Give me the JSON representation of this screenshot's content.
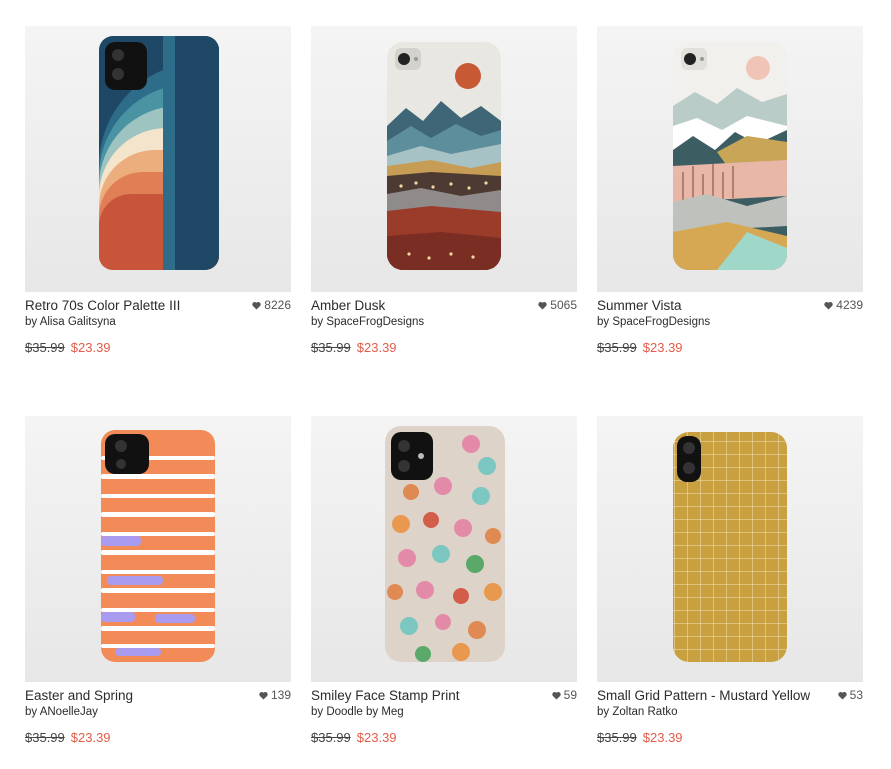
{
  "products": [
    {
      "title": "Retro 70s Color Palette III",
      "artist": "by Alisa Galitsyna",
      "likes": "8226",
      "original_price": "$35.99",
      "sale_price": "$23.39"
    },
    {
      "title": "Amber Dusk",
      "artist": "by SpaceFrogDesigns",
      "likes": "5065",
      "original_price": "$35.99",
      "sale_price": "$23.39"
    },
    {
      "title": "Summer Vista",
      "artist": "by SpaceFrogDesigns",
      "likes": "4239",
      "original_price": "$35.99",
      "sale_price": "$23.39"
    },
    {
      "title": "Easter and Spring",
      "artist": "by ANoelleJay",
      "likes": "139",
      "original_price": "$35.99",
      "sale_price": "$23.39"
    },
    {
      "title": "Smiley Face Stamp Print",
      "artist": "by Doodle by Meg",
      "likes": "59",
      "original_price": "$35.99",
      "sale_price": "$23.39"
    },
    {
      "title": "Small Grid Pattern - Mustard Yellow",
      "artist": "by Zoltan Ratko",
      "likes": "53",
      "original_price": "$35.99",
      "sale_price": "$23.39"
    }
  ],
  "icons": {
    "like": "heart-icon"
  },
  "colors": {
    "sale_price": "#e25d4b",
    "mustard": "#c9a03f"
  }
}
